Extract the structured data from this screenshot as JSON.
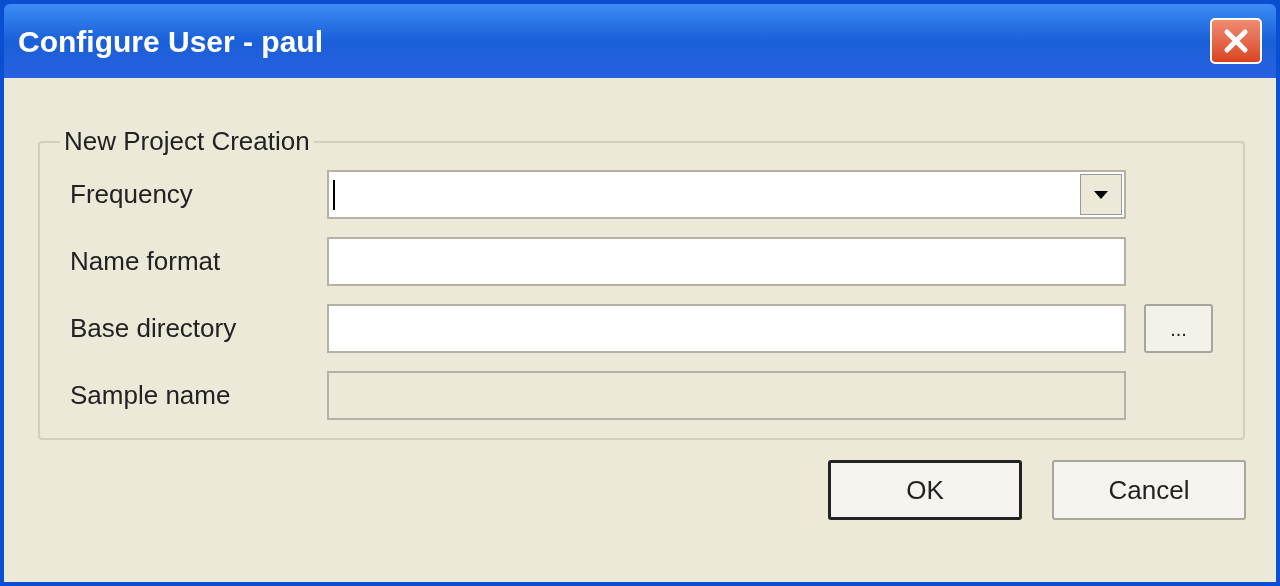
{
  "window": {
    "title": "Configure User - paul"
  },
  "group": {
    "legend": "New Project Creation",
    "fields": [
      {
        "label": "Frequency",
        "kind": "dropdown",
        "disabled": false,
        "focused": true
      },
      {
        "label": "Name format",
        "kind": "text",
        "disabled": false,
        "focused": false
      },
      {
        "label": "Base directory",
        "kind": "browse",
        "disabled": false,
        "focused": false,
        "button": "..."
      },
      {
        "label": "Sample name",
        "kind": "text",
        "disabled": true,
        "focused": false
      }
    ]
  },
  "buttons": [
    {
      "label": "OK",
      "default": true
    },
    {
      "label": "Cancel",
      "default": false
    }
  ]
}
